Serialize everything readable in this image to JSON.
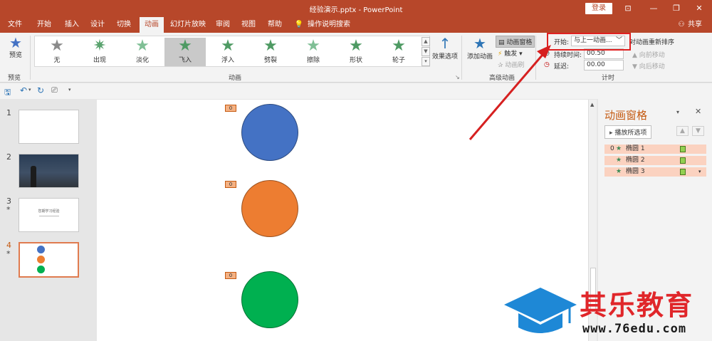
{
  "window": {
    "title": "经验演示.pptx - PowerPoint",
    "login_label": "登录",
    "share_label": "共享"
  },
  "tabs": [
    "文件",
    "开始",
    "插入",
    "设计",
    "切换",
    "动画",
    "幻灯片放映",
    "审阅",
    "视图",
    "帮助"
  ],
  "tell_me": "操作说明搜索",
  "ribbon": {
    "preview": {
      "button_label": "预览",
      "group_label": "预览"
    },
    "animation_gallery": {
      "group_label": "动画",
      "items": [
        "无",
        "出现",
        "淡化",
        "飞入",
        "浮入",
        "劈裂",
        "擦除",
        "形状",
        "轮子"
      ],
      "selected": "飞入"
    },
    "effect_options_label": "效果选项",
    "advanced": {
      "group_label": "高级动画",
      "add_animation": "添加动画",
      "animation_pane": "动画窗格",
      "trigger": "触发",
      "painter": "动画刷"
    },
    "timing": {
      "group_label": "计时",
      "start_label": "开始:",
      "start_value": "与上一动画...",
      "duration_label": "持续时间:",
      "duration_value": "00.50",
      "delay_label": "延迟:",
      "delay_value": "00.00",
      "reorder_label": "对动画重新排序",
      "move_earlier": "向前移动",
      "move_later": "向后移动"
    }
  },
  "slides": [
    {
      "number": "1",
      "star": ""
    },
    {
      "number": "2",
      "star": ""
    },
    {
      "number": "3",
      "star": "*",
      "thumb_text": "您期学习经验"
    },
    {
      "number": "4",
      "star": "*"
    }
  ],
  "canvas": {
    "tags": [
      "0",
      "0",
      "0"
    ],
    "shape_colors": [
      "#4472c4",
      "#ed7d31",
      "#00b050"
    ]
  },
  "animation_pane": {
    "title": "动画窗格",
    "play_label": "播放所选项",
    "items": [
      {
        "index": "0",
        "name": "椭圆 1"
      },
      {
        "index": "",
        "name": "椭圆 2"
      },
      {
        "index": "",
        "name": "椭圆 3"
      }
    ]
  },
  "watermark": {
    "brand": "其乐教育",
    "url": "www.76edu.com"
  },
  "colors": {
    "accent": "#b7472a",
    "highlight_box": "#e02020"
  }
}
